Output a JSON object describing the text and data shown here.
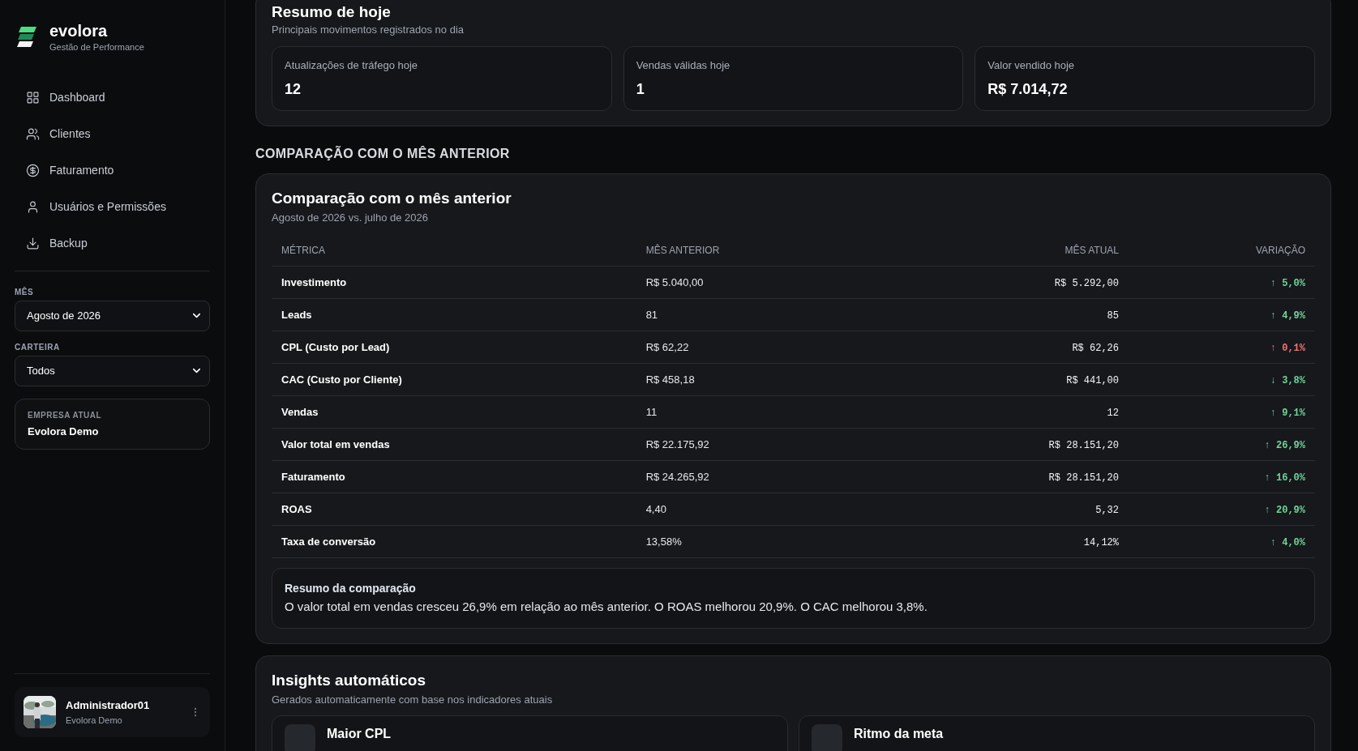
{
  "brand": {
    "name": "evolora",
    "tagline": "Gestão de Performance"
  },
  "nav": [
    {
      "label": "Dashboard",
      "selected": false
    },
    {
      "label": "Clientes",
      "selected": false
    },
    {
      "label": "Faturamento",
      "selected": false
    },
    {
      "label": "Usuários e Permissões",
      "selected": false
    },
    {
      "label": "Backup",
      "selected": false
    }
  ],
  "filters": [
    {
      "label": "MÊS",
      "value": "Agosto de 2026"
    },
    {
      "label": "CARTEIRA",
      "value": "Todos"
    }
  ],
  "company": {
    "label": "EMPRESA ATUAL",
    "name": "Evolora Demo"
  },
  "user": {
    "name": "Administrador01",
    "company": "Evolora Demo"
  },
  "today": {
    "title": "Resumo de hoje",
    "subtitle": "Principais movimentos registrados no dia",
    "stats": [
      {
        "label": "Atualizações de tráfego hoje",
        "value": "12"
      },
      {
        "label": "Vendas válidas hoje",
        "value": "1"
      },
      {
        "label": "Valor vendido hoje",
        "value": "R$ 7.014,72"
      }
    ]
  },
  "section_heading": "COMPARAÇÃO COM O MÊS ANTERIOR",
  "comparison": {
    "title": "Comparação com o mês anterior",
    "subtitle": "Agosto de 2026 vs. julho de 2026",
    "columns": [
      "MÉTRICA",
      "MÊS ANTERIOR",
      "MÊS ATUAL",
      "VARIAÇÃO"
    ],
    "rows": [
      {
        "metric": "Investimento",
        "previous": "R$ 5.040,00",
        "current": "R$ 5.292,00",
        "change": "↑ 5,0%",
        "color": "#6fd39b"
      },
      {
        "metric": "Leads",
        "previous": "81",
        "current": "85",
        "change": "↑ 4,9%",
        "color": "#6fd39b"
      },
      {
        "metric": "CPL (Custo por Lead)",
        "previous": "R$ 62,22",
        "current": "R$ 62,26",
        "change": "↑ 0,1%",
        "color": "#f87171"
      },
      {
        "metric": "CAC (Custo por Cliente)",
        "previous": "R$ 458,18",
        "current": "R$ 441,00",
        "change": "↓ 3,8%",
        "color": "#6fd39b"
      },
      {
        "metric": "Vendas",
        "previous": "11",
        "current": "12",
        "change": "↑ 9,1%",
        "color": "#6fd39b"
      },
      {
        "metric": "Valor total em vendas",
        "previous": "R$ 22.175,92",
        "current": "R$ 28.151,20",
        "change": "↑ 26,9%",
        "color": "#6fd39b"
      },
      {
        "metric": "Faturamento",
        "previous": "R$ 24.265,92",
        "current": "R$ 28.151,20",
        "change": "↑ 16,0%",
        "color": "#6fd39b"
      },
      {
        "metric": "ROAS",
        "previous": "4,40",
        "current": "5,32",
        "change": "↑ 20,9%",
        "color": "#6fd39b"
      },
      {
        "metric": "Taxa de conversão",
        "previous": "13,58%",
        "current": "14,12%",
        "change": "↑ 4,0%",
        "color": "#6fd39b"
      }
    ],
    "summary": {
      "title": "Resumo da comparação",
      "text": "O valor total em vendas cresceu 26,9% em relação ao mês anterior. O ROAS melhorou 20,9%. O CAC melhorou 3,8%."
    }
  },
  "insights": {
    "title": "Insights automáticos",
    "subtitle": "Gerados automaticamente com base nos indicadores atuais",
    "items": [
      {
        "title": "Maior CPL"
      },
      {
        "title": "Ritmo da meta"
      }
    ]
  }
}
